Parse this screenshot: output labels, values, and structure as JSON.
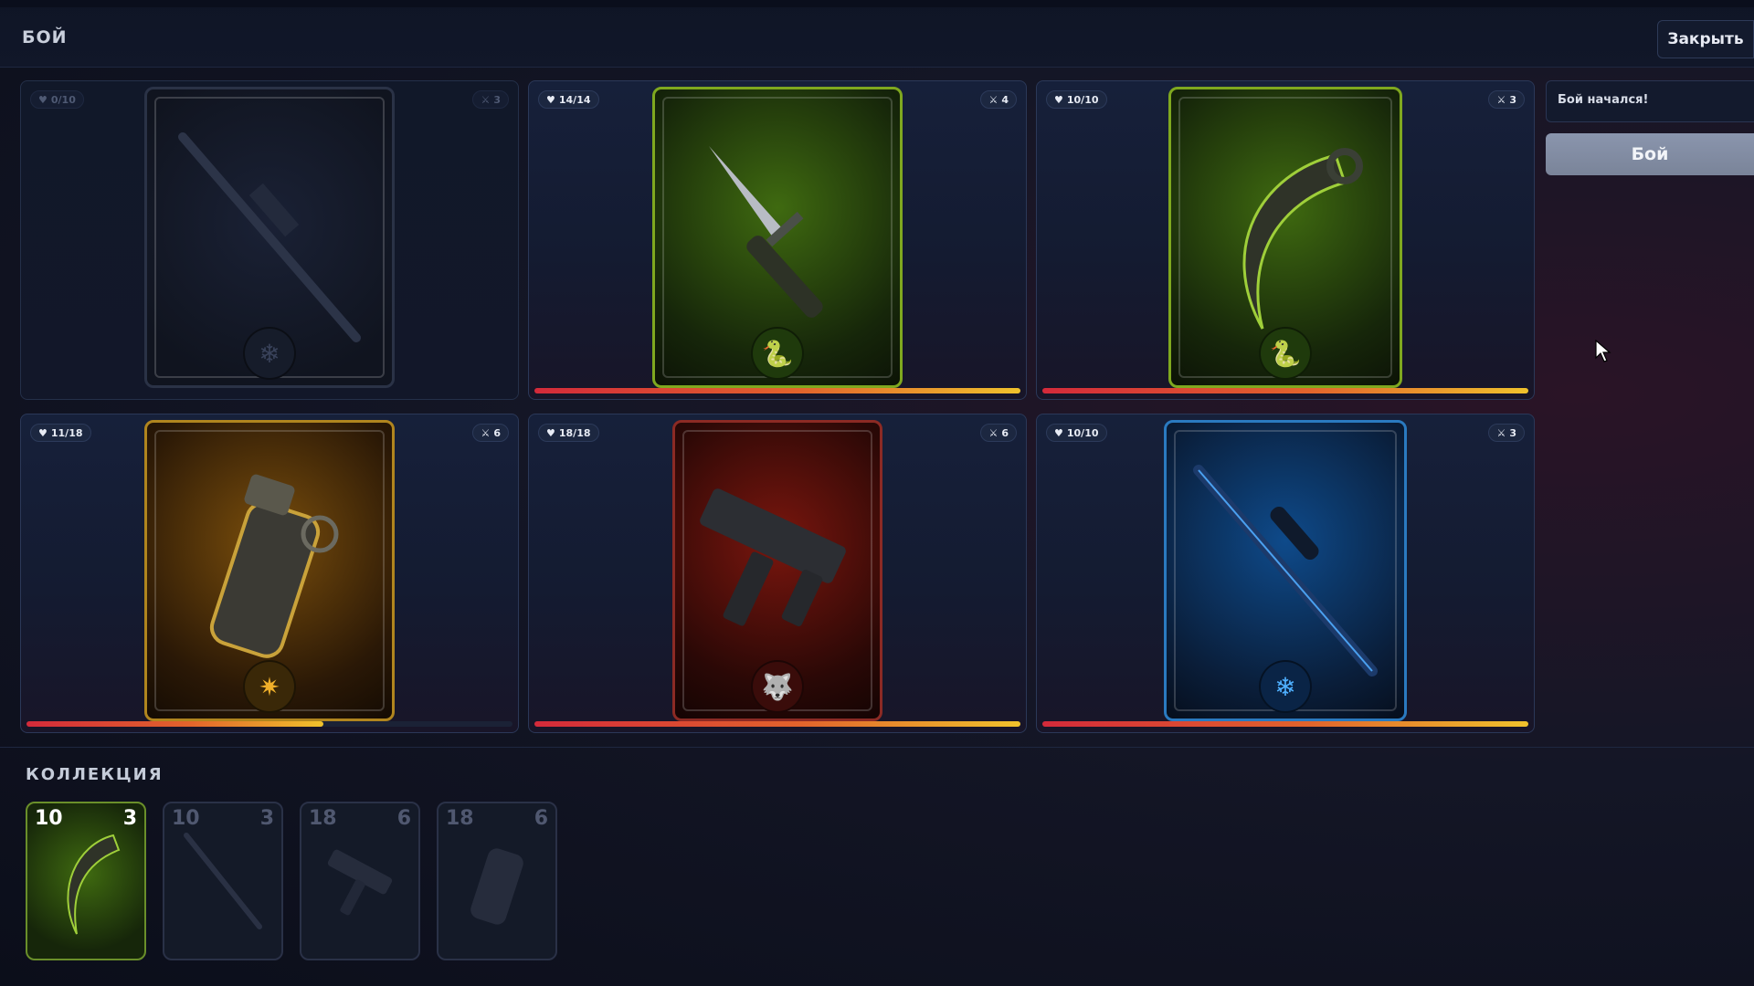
{
  "header": {
    "title": "БОЙ",
    "close_label": "Закрыть"
  },
  "battle": {
    "cards": [
      {
        "hp": "0/10",
        "atk": "3",
        "weapon": "sniper-rifle",
        "emblem": "snowflake-icon",
        "theme": "dim",
        "hp_fraction": 0
      },
      {
        "hp": "14/14",
        "atk": "4",
        "weapon": "combat-knife",
        "emblem": "snake-icon",
        "theme": "green",
        "hp_fraction": 1
      },
      {
        "hp": "10/10",
        "atk": "3",
        "weapon": "karambit",
        "emblem": "snake-icon",
        "theme": "green",
        "hp_fraction": 1
      },
      {
        "hp": "11/18",
        "atk": "6",
        "weapon": "grenade",
        "emblem": "sun-icon",
        "theme": "gold",
        "hp_fraction": 0.61
      },
      {
        "hp": "18/18",
        "atk": "6",
        "weapon": "smg",
        "emblem": "wolf-icon",
        "theme": "red",
        "hp_fraction": 1
      },
      {
        "hp": "10/10",
        "atk": "3",
        "weapon": "sniper-rifle",
        "emblem": "snowflake-icon",
        "theme": "blue",
        "hp_fraction": 1
      }
    ]
  },
  "sidebar": {
    "log_text": "Бой начался!",
    "fight_label": "Бой"
  },
  "collection": {
    "title": "КОЛЛЕКЦИЯ",
    "items": [
      {
        "hp": "10",
        "atk": "3",
        "weapon": "karambit",
        "theme": "green"
      },
      {
        "hp": "10",
        "atk": "3",
        "weapon": "sniper-rifle",
        "theme": "dim"
      },
      {
        "hp": "18",
        "atk": "6",
        "weapon": "smg",
        "theme": "dim"
      },
      {
        "hp": "18",
        "atk": "6",
        "weapon": "grenade",
        "theme": "dim"
      }
    ]
  },
  "colors": {
    "green": "#7fc21f",
    "gold": "#d69a1c",
    "red": "#c22a22",
    "blue": "#2a8fe0",
    "dim": "#3a4258"
  }
}
